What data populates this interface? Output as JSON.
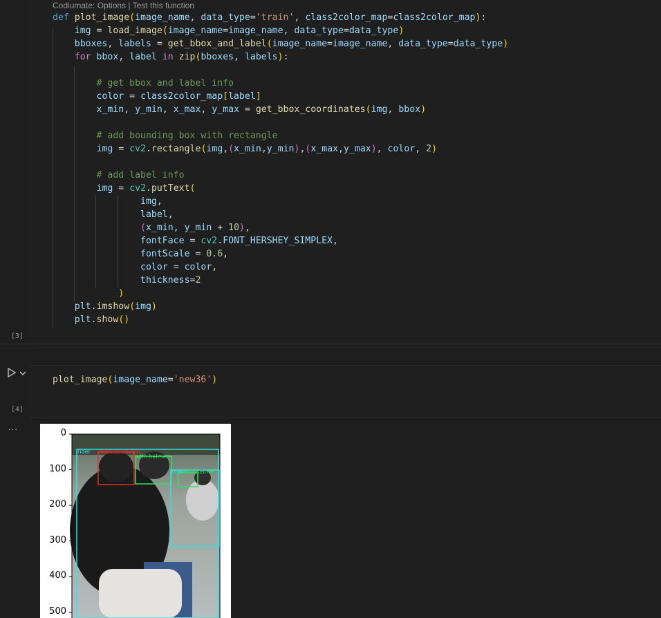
{
  "codelens": "Codiumate: Options | Test this function",
  "cell1": {
    "exec_count": "[3]",
    "lines": [
      [
        [
          "kw",
          "def "
        ],
        [
          "fn",
          "plot_image"
        ],
        [
          "p1",
          "("
        ],
        [
          "va",
          "image_name"
        ],
        [
          "",
          ","
        ],
        [
          "va",
          " data_type"
        ],
        [
          "",
          "="
        ],
        [
          "st",
          "'train'"
        ],
        [
          "",
          ", "
        ],
        [
          "va",
          "class2color_map"
        ],
        [
          "",
          "="
        ],
        [
          "va",
          "class2color_map"
        ],
        [
          "p1",
          ")"
        ],
        [
          "",
          ":"
        ]
      ],
      [
        [
          "",
          "    "
        ],
        [
          "va",
          "img"
        ],
        [
          "",
          " = "
        ],
        [
          "fn",
          "load_image"
        ],
        [
          "p1",
          "("
        ],
        [
          "va",
          "image_name"
        ],
        [
          "",
          "="
        ],
        [
          "va",
          "image_name"
        ],
        [
          "",
          ", "
        ],
        [
          "va",
          "data_type"
        ],
        [
          "",
          "="
        ],
        [
          "va",
          "data_type"
        ],
        [
          "p1",
          ")"
        ]
      ],
      [
        [
          "",
          "    "
        ],
        [
          "va",
          "bboxes"
        ],
        [
          "",
          ", "
        ],
        [
          "va",
          "labels"
        ],
        [
          "",
          " = "
        ],
        [
          "fn",
          "get_bbox_and_label"
        ],
        [
          "p1",
          "("
        ],
        [
          "va",
          "image_name"
        ],
        [
          "",
          "="
        ],
        [
          "va",
          "image_name"
        ],
        [
          "",
          ", "
        ],
        [
          "va",
          "data_type"
        ],
        [
          "",
          "="
        ],
        [
          "va",
          "data_type"
        ],
        [
          "p1",
          ")"
        ]
      ],
      [
        [
          "",
          "    "
        ],
        [
          "kw2",
          "for "
        ],
        [
          "va",
          "bbox"
        ],
        [
          "",
          ", "
        ],
        [
          "va",
          "label"
        ],
        [
          "kw2",
          " in "
        ],
        [
          "fn",
          "zip"
        ],
        [
          "p1",
          "("
        ],
        [
          "va",
          "bboxes"
        ],
        [
          "",
          ", "
        ],
        [
          "va",
          "labels"
        ],
        [
          "p1",
          ")"
        ],
        [
          "",
          ":"
        ]
      ],
      [
        [
          "",
          ""
        ]
      ],
      [
        [
          "",
          "        "
        ],
        [
          "cm",
          "# get bbox and label info"
        ]
      ],
      [
        [
          "",
          "        "
        ],
        [
          "va",
          "color"
        ],
        [
          "",
          " = "
        ],
        [
          "va",
          "class2color_map"
        ],
        [
          "p1",
          "["
        ],
        [
          "va",
          "label"
        ],
        [
          "p1",
          "]"
        ]
      ],
      [
        [
          "",
          "        "
        ],
        [
          "va",
          "x_min"
        ],
        [
          "",
          ", "
        ],
        [
          "va",
          "y_min"
        ],
        [
          "",
          ", "
        ],
        [
          "va",
          "x_max"
        ],
        [
          "",
          ", "
        ],
        [
          "va",
          "y_max"
        ],
        [
          "",
          " = "
        ],
        [
          "fn",
          "get_bbox_coordinates"
        ],
        [
          "p1",
          "("
        ],
        [
          "va",
          "img"
        ],
        [
          "",
          ", "
        ],
        [
          "va",
          "bbox"
        ],
        [
          "p1",
          ")"
        ]
      ],
      [
        [
          "",
          ""
        ]
      ],
      [
        [
          "",
          "        "
        ],
        [
          "cm",
          "# add bounding box with rectangle"
        ]
      ],
      [
        [
          "",
          "        "
        ],
        [
          "va",
          "img"
        ],
        [
          "",
          " = "
        ],
        [
          "bi",
          "cv2"
        ],
        [
          "",
          "."
        ],
        [
          "fn",
          "rectangle"
        ],
        [
          "p1",
          "("
        ],
        [
          "va",
          "img"
        ],
        [
          "",
          ","
        ],
        [
          "p2",
          "("
        ],
        [
          "va",
          "x_min"
        ],
        [
          "",
          ","
        ],
        [
          "va",
          "y_min"
        ],
        [
          "p2",
          ")"
        ],
        [
          "",
          ","
        ],
        [
          "p2",
          "("
        ],
        [
          "va",
          "x_max"
        ],
        [
          "",
          ","
        ],
        [
          "va",
          "y_max"
        ],
        [
          "p2",
          ")"
        ],
        [
          "",
          ", "
        ],
        [
          "va",
          "color"
        ],
        [
          "",
          ", "
        ],
        [
          "nu",
          "2"
        ],
        [
          "p1",
          ")"
        ]
      ],
      [
        [
          "",
          ""
        ]
      ],
      [
        [
          "",
          "        "
        ],
        [
          "cm",
          "# add label info"
        ]
      ],
      [
        [
          "",
          "        "
        ],
        [
          "va",
          "img"
        ],
        [
          "",
          " = "
        ],
        [
          "bi",
          "cv2"
        ],
        [
          "",
          "."
        ],
        [
          "fn",
          "putText"
        ],
        [
          "p1",
          "("
        ]
      ],
      [
        [
          "",
          "                "
        ],
        [
          "va",
          "img"
        ],
        [
          "",
          ","
        ]
      ],
      [
        [
          "",
          "                "
        ],
        [
          "va",
          "label"
        ],
        [
          "",
          ","
        ]
      ],
      [
        [
          "",
          "                "
        ],
        [
          "p2",
          "("
        ],
        [
          "va",
          "x_min"
        ],
        [
          "",
          ", "
        ],
        [
          "va",
          "y_min"
        ],
        [
          "",
          " + "
        ],
        [
          "nu",
          "10"
        ],
        [
          "p2",
          ")"
        ],
        [
          "",
          ","
        ]
      ],
      [
        [
          "",
          "                "
        ],
        [
          "va",
          "fontFace"
        ],
        [
          "",
          " = "
        ],
        [
          "bi",
          "cv2"
        ],
        [
          "",
          "."
        ],
        [
          "va",
          "FONT_HERSHEY_SIMPLEX"
        ],
        [
          "",
          ","
        ]
      ],
      [
        [
          "",
          "                "
        ],
        [
          "va",
          "fontScale"
        ],
        [
          "",
          " = "
        ],
        [
          "nu",
          "0.6"
        ],
        [
          "",
          ","
        ]
      ],
      [
        [
          "",
          "                "
        ],
        [
          "va",
          "color"
        ],
        [
          "",
          " = "
        ],
        [
          "va",
          "color"
        ],
        [
          "",
          ","
        ]
      ],
      [
        [
          "",
          "                "
        ],
        [
          "va",
          "thickness"
        ],
        [
          "",
          "="
        ],
        [
          "nu",
          "2"
        ]
      ],
      [
        [
          "",
          "            "
        ],
        [
          "p1",
          ")"
        ]
      ],
      [
        [
          "",
          "    "
        ],
        [
          "va",
          "plt"
        ],
        [
          "",
          "."
        ],
        [
          "fn",
          "imshow"
        ],
        [
          "p1",
          "("
        ],
        [
          "va",
          "img"
        ],
        [
          "p1",
          ")"
        ]
      ],
      [
        [
          "",
          "    "
        ],
        [
          "va",
          "plt"
        ],
        [
          "",
          "."
        ],
        [
          "fn",
          "show"
        ],
        [
          "p1",
          "()"
        ]
      ]
    ]
  },
  "cell2": {
    "exec_count": "[4]",
    "code": [
      [
        "fn",
        "plot_image"
      ],
      [
        "p1",
        "("
      ],
      [
        "va",
        "image_name"
      ],
      [
        "",
        "="
      ],
      [
        "st",
        "'new36'"
      ],
      [
        "p1",
        ")"
      ]
    ]
  },
  "output": {
    "more_label": "...",
    "yticks": [
      "0",
      "100",
      "200",
      "300",
      "400",
      "500"
    ],
    "boxes": [
      {
        "label": "rider",
        "color": "#35e0e6"
      },
      {
        "label": "without helmet",
        "color": "#e03030"
      },
      {
        "label": "with helmet",
        "color": "#30e060"
      },
      {
        "label": "rider",
        "color": "#35e0e6"
      },
      {
        "label": "with helmet",
        "color": "#30e060"
      }
    ]
  },
  "icons": {
    "run": "play-icon",
    "expand": "chevron-down-icon",
    "more": "ellipsis-icon"
  }
}
